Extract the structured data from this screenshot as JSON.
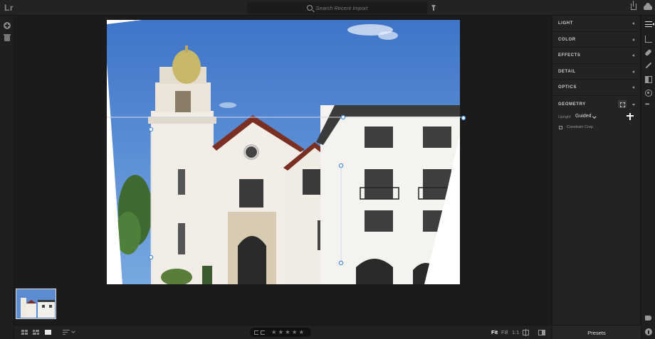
{
  "app": {
    "logo": "Lr"
  },
  "search": {
    "placeholder": "Search Recent Import"
  },
  "edit_panel": {
    "sections": [
      {
        "label": "LIGHT"
      },
      {
        "label": "COLOR"
      },
      {
        "label": "EFFECTS"
      },
      {
        "label": "DETAIL"
      },
      {
        "label": "OPTICS"
      }
    ],
    "geometry": {
      "label": "GEOMETRY",
      "upright_label": "Upright",
      "upright_value": "Guided",
      "constrain_crop": "Constrain Crop",
      "constrain_checked": false
    },
    "presets_label": "Presets"
  },
  "bottombar": {
    "zoom_options": [
      "Fit",
      "Fill",
      "1:1"
    ],
    "zoom_selected": "Fit",
    "rating_stars": 5
  },
  "colors": {
    "accent_handle": "#4a90e2",
    "sky": "#4f86d2",
    "panel_bg": "#232323"
  }
}
